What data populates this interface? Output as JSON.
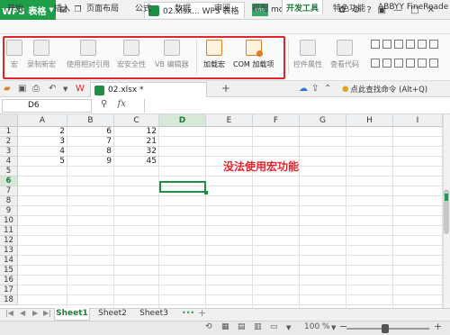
{
  "titlebar": {
    "app_button": "WPS 表格",
    "doc_tab": "02.xlsx... WPS 表格",
    "user_badge": "mo",
    "user_name": "moonsta..."
  },
  "menu_tabs": [
    "开始",
    "插入",
    "页面布局",
    "公式",
    "数据",
    "审阅",
    "视图",
    "开发工具",
    "特色功能",
    "ABBYY FineReade"
  ],
  "ribbon": {
    "buttons": [
      "宏",
      "录制新宏",
      "使用相对引用",
      "宏安全性",
      "VB 编辑器",
      "加载宏",
      "COM 加载项",
      "控件属性",
      "查看代码"
    ]
  },
  "filebar": {
    "file_tab": "02.xlsx *",
    "add": "+",
    "search_hint": "点此查找命令 (Alt+Q)"
  },
  "formula_bar": {
    "name_box": "D6",
    "fx": "fx",
    "formula": ""
  },
  "sheet": {
    "columns": [
      "A",
      "B",
      "C",
      "D",
      "E",
      "F",
      "G",
      "H",
      "I"
    ],
    "rows": [
      "1",
      "2",
      "3",
      "4",
      "5",
      "6",
      "7",
      "8",
      "9",
      "10",
      "11",
      "12",
      "13",
      "14",
      "15",
      "16",
      "17",
      "18"
    ],
    "data": [
      [
        "2",
        "6",
        "12"
      ],
      [
        "3",
        "7",
        "21"
      ],
      [
        "4",
        "8",
        "32"
      ],
      [
        "5",
        "9",
        "45"
      ]
    ],
    "active_cell": "D6",
    "annotation": "没法使用宏功能"
  },
  "sheet_tabs": [
    "Sheet1",
    "Sheet2",
    "Sheet3"
  ],
  "statusbar": {
    "zoom": "100 %",
    "minus": "−",
    "plus": "+"
  }
}
